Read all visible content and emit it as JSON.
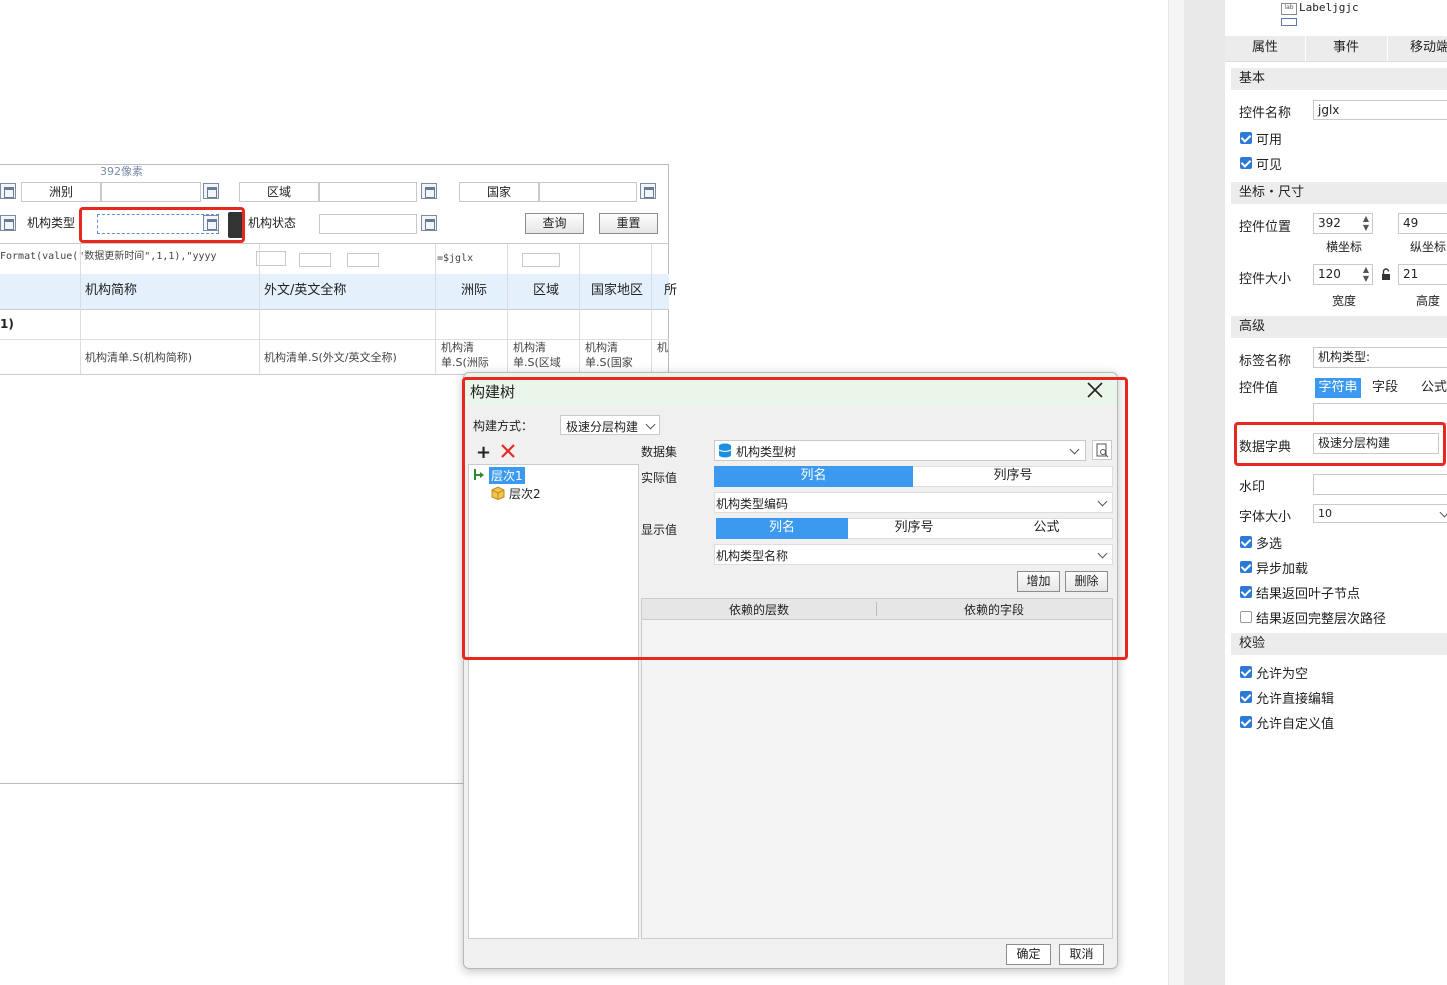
{
  "designer": {
    "ruler_label": "392像素",
    "filters": {
      "continent_label": "洲别",
      "region_label": "区域",
      "country_label": "国家",
      "org_type_label": "机构类型",
      "org_status_label": "机构状态",
      "query_button": "查询",
      "reset_button": "重置"
    },
    "formula_text": "Format(value(\"数据更新时间\",1,1),\"yyyy",
    "formula_text2": "=$jglx",
    "columns": [
      "机构简称",
      "外文/英文全称",
      "洲际",
      "区域",
      "国家地区",
      "所"
    ],
    "row1_fragment": "1)",
    "row2_cells": [
      "机构清单.S(机构简称)",
      "机构清单.S(外文/英文全称)",
      "机构清单.S(洲际",
      "机构清单.S(区域",
      "机构清单.S(国家",
      "机"
    ]
  },
  "dialog": {
    "title": "构建树",
    "build_mode_label": "构建方式：",
    "build_mode_value": "极速分层构建",
    "tree": {
      "levels": [
        "层次1",
        "层次2"
      ]
    },
    "dataset_label": "数据集",
    "dataset_value": "机构类型树",
    "actual_value_label": "实际值",
    "actual_tabs": [
      "列名",
      "列序号"
    ],
    "actual_field": "机构类型编码",
    "display_value_label": "显示值",
    "display_tabs": [
      "列名",
      "列序号",
      "公式"
    ],
    "display_field": "机构类型名称",
    "add_button": "增加",
    "delete_button": "删除",
    "dep_table_headers": [
      "依赖的层数",
      "依赖的字段"
    ],
    "ok_button": "确定",
    "cancel_button": "取消"
  },
  "panel": {
    "top_item": "Labeljgjc",
    "tabs": [
      "属性",
      "事件",
      "移动端"
    ],
    "basic_section": "基本",
    "name_label": "控件名称",
    "name_value": "jglx",
    "enabled_label": "可用",
    "visible_label": "可见",
    "coord_section": "坐标・尺寸",
    "position_label": "控件位置",
    "pos_x": "392",
    "pos_y": "49",
    "x_caption": "横坐标",
    "y_caption": "纵坐标",
    "size_label": "控件大小",
    "width_value": "120",
    "height_value": "21",
    "width_caption": "宽度",
    "height_caption": "高度",
    "advanced_section": "高级",
    "tag_label": "标签名称",
    "tag_value": "机构类型:",
    "value_label": "控件值",
    "value_tabs": [
      "字符串",
      "字段",
      "公式"
    ],
    "dict_label": "数据字典",
    "dict_value": "极速分层构建",
    "watermark_label": "水印",
    "font_label": "字体大小",
    "font_value": "10",
    "multi_label": "多选",
    "async_label": "异步加载",
    "leaf_label": "结果返回叶子节点",
    "fullpath_label": "结果返回完整层次路径",
    "check_section": "校验",
    "allow_empty_label": "允许为空",
    "allow_edit_label": "允许直接编辑",
    "allow_custom_label": "允许自定义值"
  },
  "colors": {
    "accent": "#3b9af0",
    "highlight": "#e8281e",
    "dialog_title_bg": "#eaf6ea"
  }
}
